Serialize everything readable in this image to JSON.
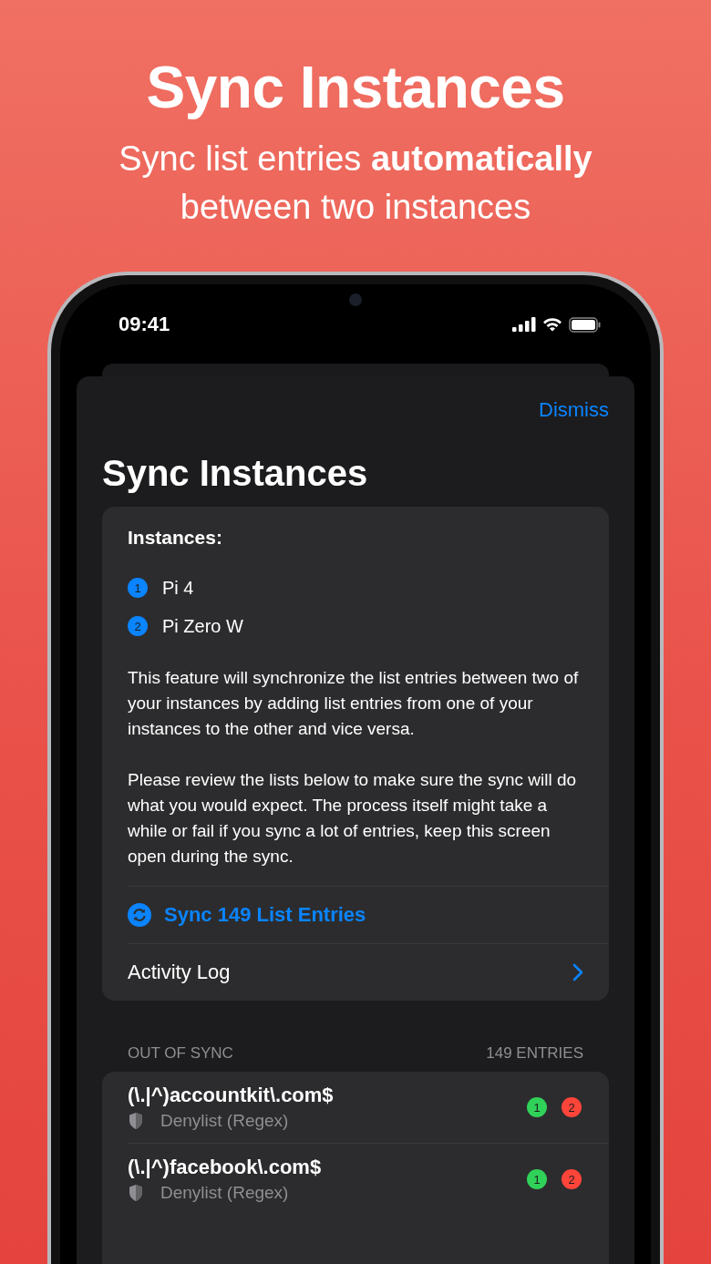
{
  "headline": {
    "title": "Sync Instances",
    "subtitle": "Sync list entries **automatically** between two instances"
  },
  "status_bar": {
    "time": "09:41"
  },
  "sheet": {
    "dismiss": "Dismiss",
    "title": "Sync Instances",
    "instances": {
      "heading": "Instances:",
      "items": [
        {
          "number": "1",
          "name": "Pi 4"
        },
        {
          "number": "2",
          "name": "Pi Zero W"
        }
      ]
    },
    "paragraphs": [
      "This feature will synchronize the list entries between two of your instances by adding list entries from one of your instances to the other and vice versa.",
      "Please review the lists below to make sure the sync will do what you would expect. The process itself might take a while or fail if you sync a lot of entries, keep this screen open during the sync."
    ],
    "sync_action": "Sync 149 List Entries",
    "activity_log": "Activity Log",
    "out_of_sync": {
      "heading": "OUT OF SYNC",
      "count": "149 ENTRIES",
      "entries": [
        {
          "domain": "(\\.|^)accountkit\\.com$",
          "list": "Denylist (Regex)",
          "badges": [
            {
              "number": "1",
              "color": "#30d158"
            },
            {
              "number": "2",
              "color": "#ff453a"
            }
          ]
        },
        {
          "domain": "(\\.|^)facebook\\.com$",
          "list": "Denylist (Regex)",
          "badges": [
            {
              "number": "1",
              "color": "#30d158"
            },
            {
              "number": "2",
              "color": "#ff453a"
            }
          ]
        }
      ]
    }
  }
}
